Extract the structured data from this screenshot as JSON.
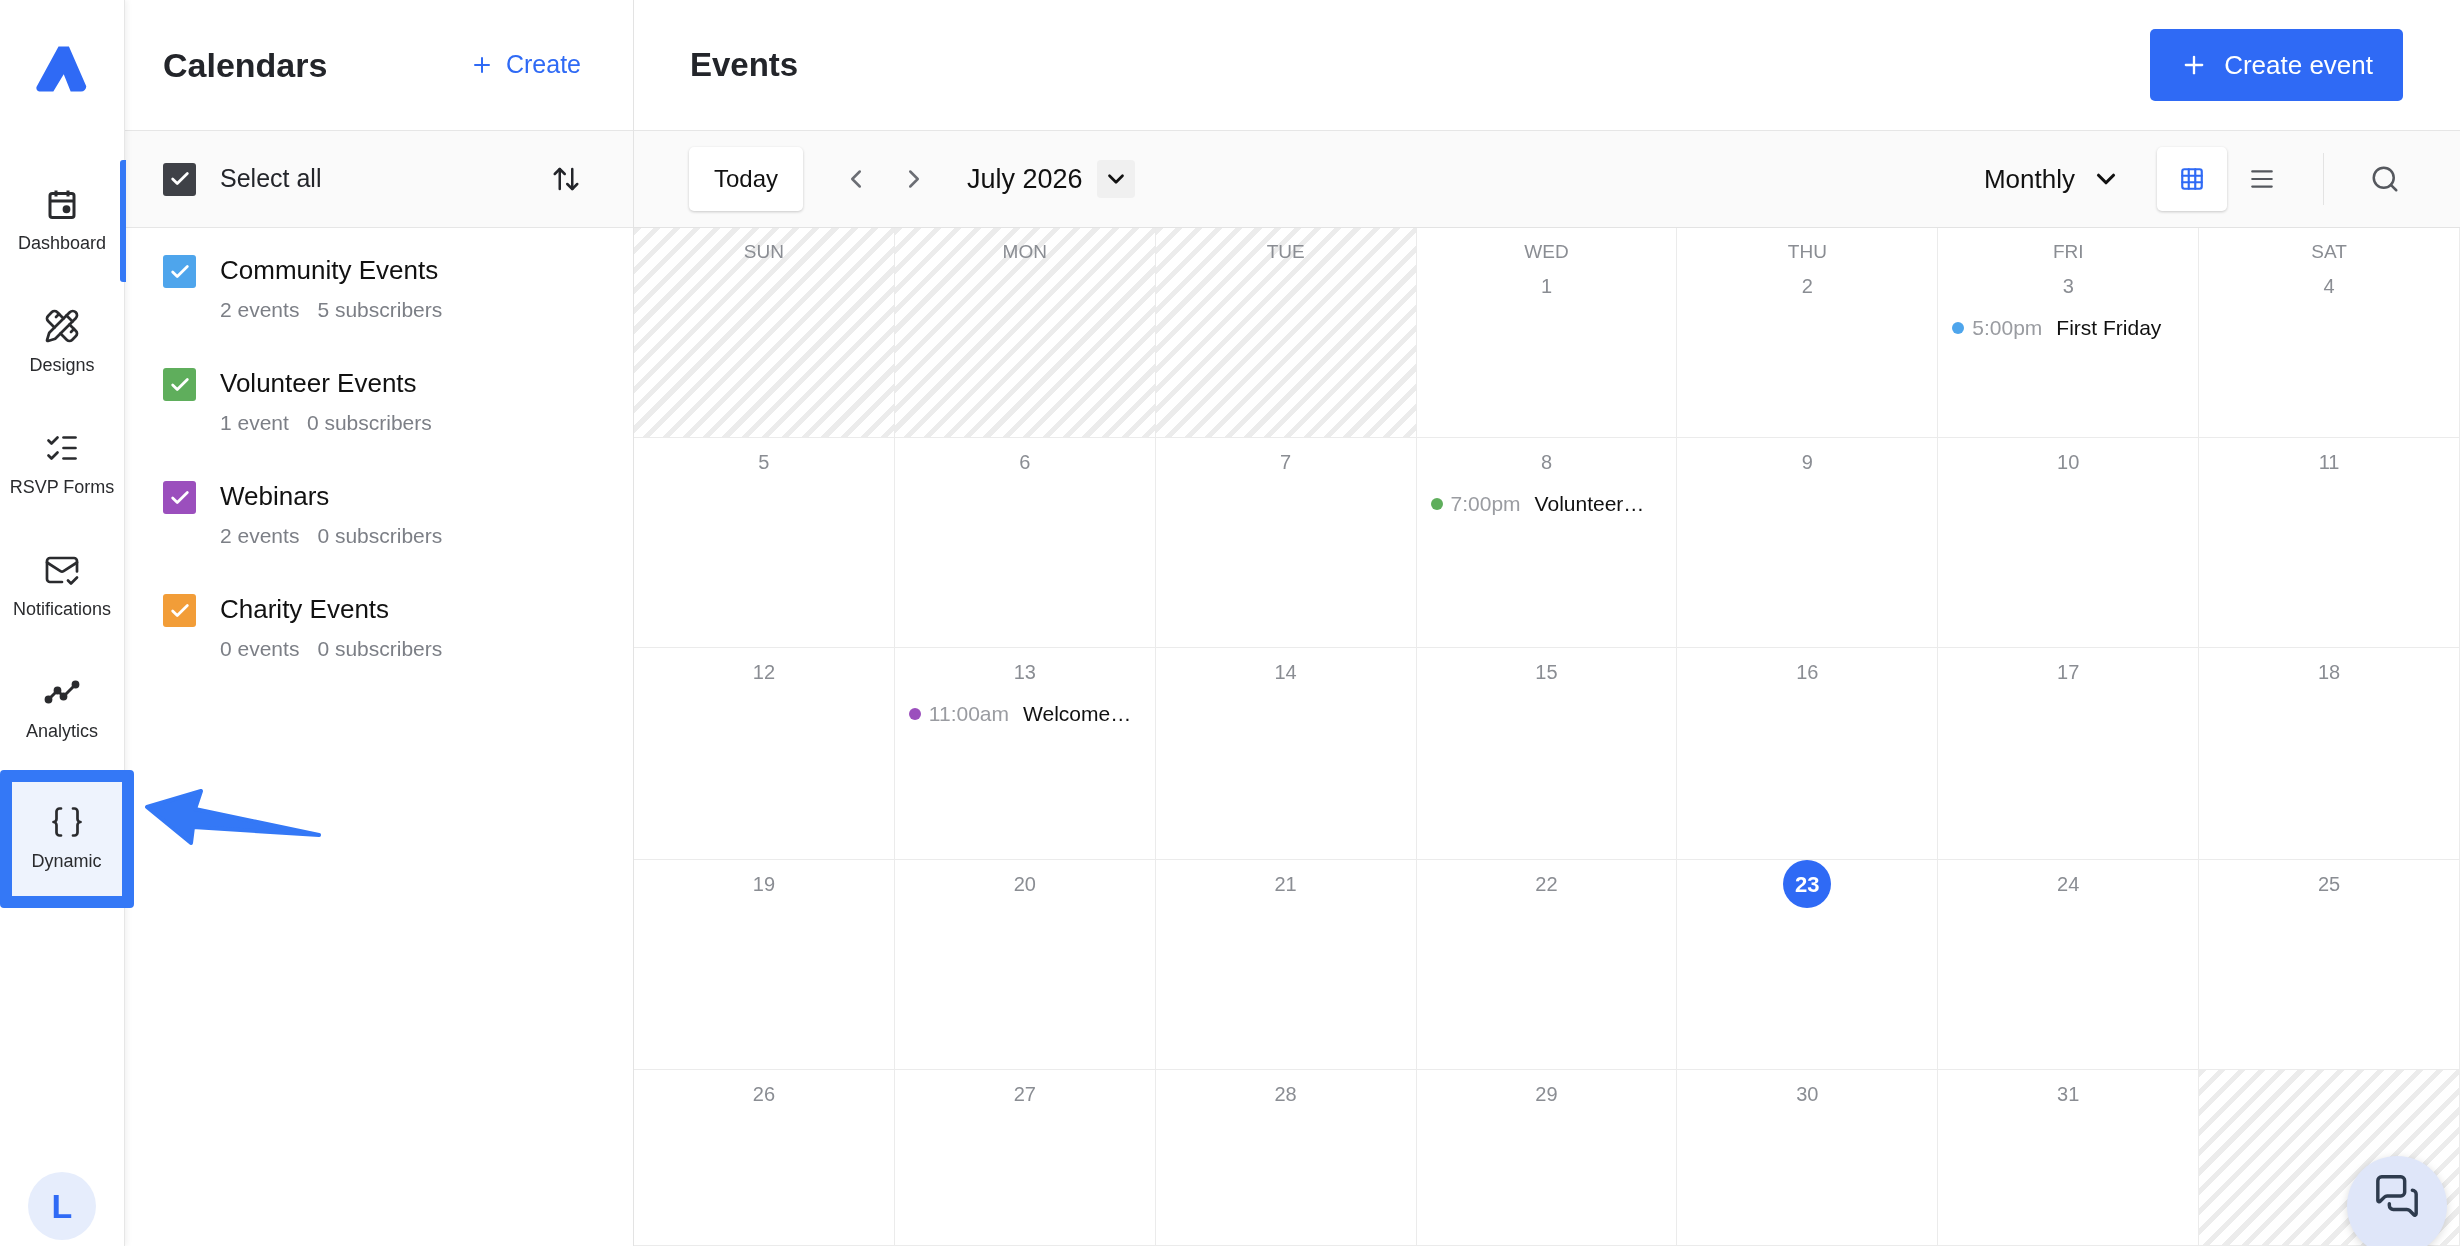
{
  "sidebar": {
    "items": [
      {
        "kind": "dashboard",
        "label": "Dashboard",
        "selected": true,
        "highlighted": false
      },
      {
        "kind": "designs",
        "label": "Designs",
        "selected": false,
        "highlighted": false
      },
      {
        "kind": "forms",
        "label": "RSVP Forms",
        "selected": false,
        "highlighted": false
      },
      {
        "kind": "notifications",
        "label": "Notifications",
        "selected": false,
        "highlighted": false
      },
      {
        "kind": "analytics",
        "label": "Analytics",
        "selected": false,
        "highlighted": false
      },
      {
        "kind": "dynamic",
        "label": "Dynamic",
        "selected": false,
        "highlighted": true
      }
    ],
    "avatar": "L"
  },
  "calendars": {
    "title": "Calendars",
    "create": "Create",
    "select_all": {
      "label": "Select all",
      "checked": true
    },
    "items": [
      {
        "name": "Community Events",
        "events": "2 events",
        "subscribers": "5 subscribers",
        "checked": true,
        "color": "#4ea5ec"
      },
      {
        "name": "Volunteer Events",
        "events": "1 event",
        "subscribers": "0 subscribers",
        "checked": true,
        "color": "#5fae5c"
      },
      {
        "name": "Webinars",
        "events": "2 events",
        "subscribers": "0 subscribers",
        "checked": true,
        "color": "#9b4fbd"
      },
      {
        "name": "Charity Events",
        "events": "0 events",
        "subscribers": "0 subscribers",
        "checked": true,
        "color": "#f29d38"
      }
    ]
  },
  "events": {
    "title": "Events",
    "create_button": "Create event",
    "toolbar": {
      "today": "Today",
      "month": "July 2026",
      "view_mode": "Monthly",
      "views": [
        {
          "kind": "grid",
          "selected": true
        },
        {
          "kind": "list",
          "selected": false
        }
      ]
    },
    "weekdays": [
      "SUN",
      "MON",
      "TUE",
      "WED",
      "THU",
      "FRI",
      "SAT"
    ],
    "weeks": [
      [
        {
          "outside": true
        },
        {
          "outside": true
        },
        {
          "outside": true
        },
        {
          "day": "1",
          "outside": false,
          "today": false
        },
        {
          "day": "2",
          "outside": false,
          "today": false
        },
        {
          "day": "3",
          "outside": false,
          "today": false,
          "events": [
            {
              "time": "5:00pm",
              "title": "First Friday",
              "color": "#4ea5ec"
            }
          ]
        },
        {
          "day": "4",
          "outside": false,
          "today": false
        }
      ],
      [
        {
          "day": "5",
          "outside": false,
          "today": false
        },
        {
          "day": "6",
          "outside": false,
          "today": false
        },
        {
          "day": "7",
          "outside": false,
          "today": false
        },
        {
          "day": "8",
          "outside": false,
          "today": false,
          "events": [
            {
              "time": "7:00pm",
              "title": "Volunteer…",
              "color": "#5fae5c"
            }
          ]
        },
        {
          "day": "9",
          "outside": false,
          "today": false
        },
        {
          "day": "10",
          "outside": false,
          "today": false
        },
        {
          "day": "11",
          "outside": false,
          "today": false
        }
      ],
      [
        {
          "day": "12",
          "outside": false,
          "today": false
        },
        {
          "day": "13",
          "outside": false,
          "today": false,
          "events": [
            {
              "time": "11:00am",
              "title": "Welcome…",
              "color": "#9b4fbd"
            }
          ]
        },
        {
          "day": "14",
          "outside": false,
          "today": false
        },
        {
          "day": "15",
          "outside": false,
          "today": false
        },
        {
          "day": "16",
          "outside": false,
          "today": false
        },
        {
          "day": "17",
          "outside": false,
          "today": false
        },
        {
          "day": "18",
          "outside": false,
          "today": false
        }
      ],
      [
        {
          "day": "19",
          "outside": false,
          "today": false
        },
        {
          "day": "20",
          "outside": false,
          "today": false
        },
        {
          "day": "21",
          "outside": false,
          "today": false
        },
        {
          "day": "22",
          "outside": false,
          "today": false
        },
        {
          "day": "23",
          "outside": false,
          "today": true
        },
        {
          "day": "24",
          "outside": false,
          "today": false
        },
        {
          "day": "25",
          "outside": false,
          "today": false
        }
      ],
      [
        {
          "day": "26",
          "outside": false,
          "today": false
        },
        {
          "day": "27",
          "outside": false,
          "today": false
        },
        {
          "day": "28",
          "outside": false,
          "today": false
        },
        {
          "day": "29",
          "outside": false,
          "today": false
        },
        {
          "day": "30",
          "outside": false,
          "today": false
        },
        {
          "day": "31",
          "outside": false,
          "today": false
        },
        {
          "outside": true
        }
      ]
    ]
  }
}
